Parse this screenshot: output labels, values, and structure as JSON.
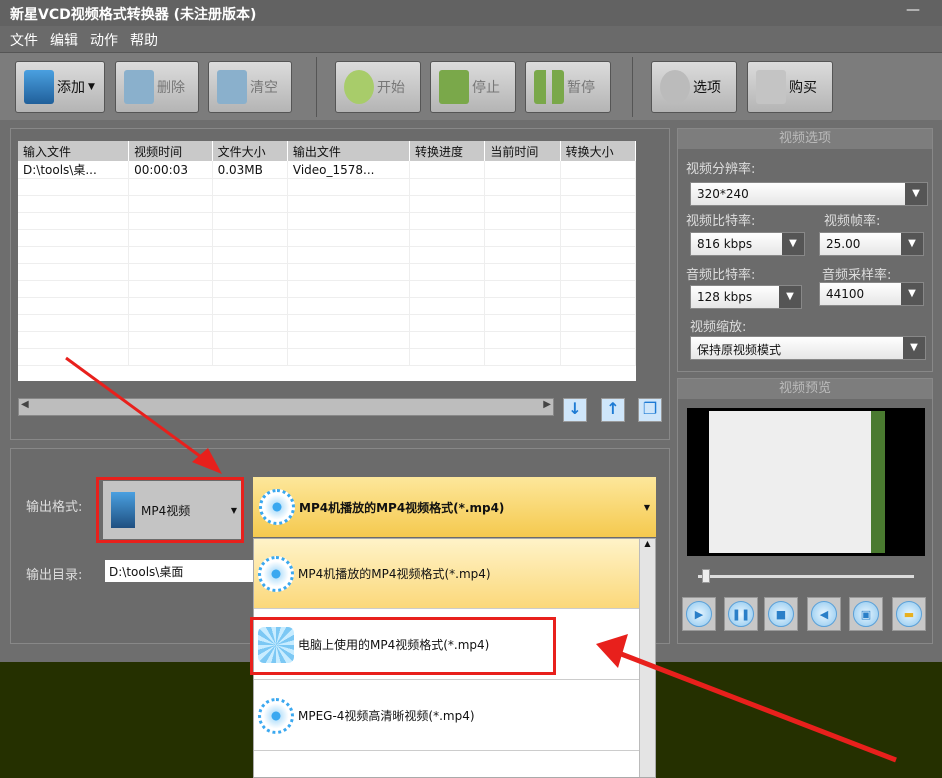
{
  "window": {
    "title": "新星VCD视频格式转换器  (未注册版本)",
    "minimize": "—"
  },
  "menu": [
    "文件",
    "编辑",
    "动作",
    "帮助"
  ],
  "toolbar": {
    "add": "添加",
    "delete": "删除",
    "clear": "清空",
    "start": "开始",
    "stop": "停止",
    "pause": "暂停",
    "options": "选项",
    "buy": "购买"
  },
  "filelist": {
    "columns": [
      "输入文件",
      "视频时间",
      "文件大小",
      "输出文件",
      "转换进度",
      "当前时间",
      "转换大小"
    ],
    "rows": [
      [
        "D:\\tools\\桌...",
        "00:00:03",
        "0.03MB",
        "Video_1578...",
        "",
        "",
        ""
      ]
    ]
  },
  "output": {
    "format_label": "输出格式:",
    "format_value": "MP4视频",
    "profile_value": "MP4机播放的MP4视频格式(*.mp4)",
    "dir_label": "输出目录:",
    "dir_value": "D:\\tools\\桌面"
  },
  "profile_options": [
    "MP4机播放的MP4视频格式(*.mp4)",
    "电脑上使用的MP4视频格式(*.mp4)",
    "MPEG-4视频高清晰视频(*.mp4)"
  ],
  "settings": {
    "title": "视频选项",
    "resolution_label": "视频分辨率:",
    "resolution": "320*240",
    "vbitrate_label": "视频比特率:",
    "vbitrate": "816 kbps",
    "fps_label": "视频帧率:",
    "fps": "25.00",
    "abitrate_label": "音频比特率:",
    "abitrate": "128 kbps",
    "samplerate_label": "音频采样率:",
    "samplerate": "44100",
    "scale_label": "视频缩放:",
    "scale": "保持原视频模式"
  },
  "preview": {
    "title": "视频预览",
    "position": 0.02
  },
  "colors": {
    "annotation": "#e8201c",
    "highlight": "#f8d96a"
  }
}
